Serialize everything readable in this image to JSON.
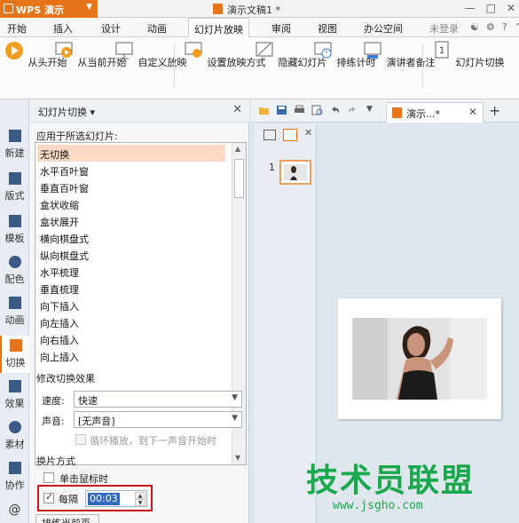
{
  "titlebar": {
    "app_name": "WPS 演示",
    "doc_title": "演示文稿1 *",
    "controls": [
      "—",
      "□",
      "✕"
    ]
  },
  "menubar": {
    "tabs": [
      "开始",
      "插入",
      "设计",
      "动画",
      "幻灯片放映",
      "审阅",
      "视图",
      "办公空间"
    ],
    "active_tab": "幻灯片放映",
    "login": "未登录"
  },
  "ribbon": {
    "buttons": [
      "从头开始",
      "从当前开始",
      "自定义放映",
      "设置放映方式",
      "隐藏幻灯片",
      "排练计时",
      "演讲者备注",
      "幻灯片切换"
    ]
  },
  "rail": {
    "items": [
      "新建",
      "版式",
      "模板",
      "配色",
      "动画",
      "切换",
      "效果",
      "素材",
      "协作",
      "@"
    ],
    "active": "切换"
  },
  "pane": {
    "title": "幻灯片切换 ▾",
    "apply_label": "应用于所选幻灯片:",
    "transitions": [
      "无切换",
      "水平百叶窗",
      "垂直百叶窗",
      "盒状收缩",
      "盒状展开",
      "横向棋盘式",
      "纵向棋盘式",
      "水平梳理",
      "垂直梳理",
      "向下插入",
      "向左插入",
      "向右插入",
      "向上插入"
    ],
    "selected_transition": "无切换",
    "modify_label": "修改切换效果",
    "speed_label": "速度:",
    "speed_value": "快速",
    "sound_label": "声音:",
    "sound_value": "[无声音]",
    "loop_label": "循环播放，到下一声音开始时",
    "advance_label": "换片方式",
    "on_click_label": "单击鼠标时",
    "every_label": "每隔",
    "every_value": "00:03",
    "apply_button": "排练当前页"
  },
  "doc_toolbar": {
    "tab_label": "演示...*"
  },
  "thumbs": {
    "slide_number": "1"
  },
  "watermark": {
    "text": "技术员联盟",
    "url": "www.jsgho.com"
  },
  "colors": {
    "accent": "#e8741a",
    "selection": "#fbd9c4",
    "highlight": "#c8171b",
    "watermark": "#1aa84c"
  }
}
